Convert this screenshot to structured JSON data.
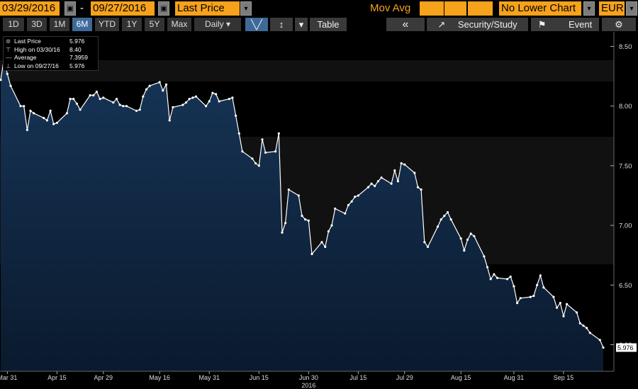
{
  "toolbar": {
    "start_date": "03/29/2016",
    "date_separator": "-",
    "end_date": "09/27/2016",
    "field": "Last Price",
    "mov_avg_label": "Mov Avg",
    "lower_chart": "No Lower Chart",
    "currency": "EUR",
    "calendar_icon": "▣",
    "dropdown_icon": "▾"
  },
  "periods": [
    "1D",
    "3D",
    "1M",
    "6M",
    "YTD",
    "1Y",
    "5Y",
    "Max"
  ],
  "active_period": "6M",
  "frequency": "Daily ▾",
  "tools": {
    "line_icon": "╲╱",
    "bar_icon": "↕",
    "dropdown": "▾",
    "table": "Table",
    "back": "«",
    "study_icon": "↗",
    "security_study": "Security/Study",
    "flag_icon": "⚑",
    "event": "Event",
    "gear_icon": "⚙"
  },
  "legend": [
    {
      "label": "Last Price",
      "value": "5.976"
    },
    {
      "label": "High on 03/30/16",
      "value": "8.40"
    },
    {
      "label": "Average",
      "value": "7.3959"
    },
    {
      "label": "Low on 09/27/16",
      "value": "5.976"
    }
  ],
  "colors": {
    "accent": "#f7a21b",
    "area_top": "#173557",
    "area_bottom": "#0a1a2e",
    "line": "#ffffff",
    "active": "#3d6a99"
  },
  "chart_data": {
    "type": "area",
    "x_axis_type": "date",
    "x_ticks": [
      "Mar 31",
      "Apr 15",
      "Apr 29",
      "May 16",
      "May 31",
      "Jun 15",
      "Jun 30",
      "Jul 15",
      "Jul 29",
      "Aug 15",
      "Aug 31",
      "Sep 15"
    ],
    "x_tick_dates": [
      "2016-03-31",
      "2016-04-15",
      "2016-04-29",
      "2016-05-16",
      "2016-05-31",
      "2016-06-15",
      "2016-06-30",
      "2016-07-15",
      "2016-07-29",
      "2016-08-15",
      "2016-08-31",
      "2016-09-15"
    ],
    "year_label": "2016",
    "y_ticks": [
      8.5,
      8.0,
      7.5,
      7.0,
      6.5,
      6.0
    ],
    "y_tick_labels": [
      "8.50",
      "8.00",
      "7.50",
      "7.00",
      "6.50",
      "6.00"
    ],
    "ylim": [
      5.75,
      8.55
    ],
    "last_value_label": "5.976",
    "grid": false,
    "series": [
      {
        "name": "Last Price",
        "x": [
          "2016-03-29",
          "2016-03-30",
          "2016-03-31",
          "2016-04-01",
          "2016-04-04",
          "2016-04-05",
          "2016-04-06",
          "2016-04-07",
          "2016-04-08",
          "2016-04-11",
          "2016-04-12",
          "2016-04-13",
          "2016-04-14",
          "2016-04-15",
          "2016-04-18",
          "2016-04-19",
          "2016-04-20",
          "2016-04-21",
          "2016-04-22",
          "2016-04-25",
          "2016-04-26",
          "2016-04-27",
          "2016-04-28",
          "2016-04-29",
          "2016-05-02",
          "2016-05-03",
          "2016-05-04",
          "2016-05-05",
          "2016-05-06",
          "2016-05-09",
          "2016-05-10",
          "2016-05-11",
          "2016-05-12",
          "2016-05-13",
          "2016-05-16",
          "2016-05-17",
          "2016-05-18",
          "2016-05-19",
          "2016-05-20",
          "2016-05-23",
          "2016-05-24",
          "2016-05-25",
          "2016-05-26",
          "2016-05-27",
          "2016-05-30",
          "2016-05-31",
          "2016-06-01",
          "2016-06-02",
          "2016-06-03",
          "2016-06-06",
          "2016-06-07",
          "2016-06-08",
          "2016-06-09",
          "2016-06-10",
          "2016-06-13",
          "2016-06-14",
          "2016-06-15",
          "2016-06-16",
          "2016-06-17",
          "2016-06-20",
          "2016-06-21",
          "2016-06-22",
          "2016-06-23",
          "2016-06-24",
          "2016-06-27",
          "2016-06-28",
          "2016-06-29",
          "2016-06-30",
          "2016-07-01",
          "2016-07-04",
          "2016-07-05",
          "2016-07-06",
          "2016-07-07",
          "2016-07-08",
          "2016-07-11",
          "2016-07-12",
          "2016-07-13",
          "2016-07-14",
          "2016-07-15",
          "2016-07-18",
          "2016-07-19",
          "2016-07-20",
          "2016-07-21",
          "2016-07-22",
          "2016-07-25",
          "2016-07-26",
          "2016-07-27",
          "2016-07-28",
          "2016-07-29",
          "2016-08-01",
          "2016-08-02",
          "2016-08-03",
          "2016-08-04",
          "2016-08-05",
          "2016-08-08",
          "2016-08-09",
          "2016-08-10",
          "2016-08-11",
          "2016-08-12",
          "2016-08-15",
          "2016-08-16",
          "2016-08-17",
          "2016-08-18",
          "2016-08-19",
          "2016-08-22",
          "2016-08-23",
          "2016-08-24",
          "2016-08-25",
          "2016-08-26",
          "2016-08-29",
          "2016-08-30",
          "2016-08-31",
          "2016-09-01",
          "2016-09-02",
          "2016-09-05",
          "2016-09-06",
          "2016-09-07",
          "2016-09-08",
          "2016-09-09",
          "2016-09-12",
          "2016-09-13",
          "2016-09-14",
          "2016-09-15",
          "2016-09-16",
          "2016-09-19",
          "2016-09-20",
          "2016-09-21",
          "2016-09-22",
          "2016-09-23",
          "2016-09-26",
          "2016-09-27"
        ],
        "y": [
          8.22,
          8.4,
          8.27,
          8.17,
          8.0,
          8.0,
          7.8,
          7.96,
          7.94,
          7.9,
          7.88,
          7.96,
          7.85,
          7.86,
          7.94,
          8.06,
          8.06,
          8.02,
          7.97,
          8.09,
          8.09,
          8.12,
          8.06,
          8.07,
          8.03,
          8.06,
          8.01,
          8.0,
          8.0,
          7.96,
          7.97,
          8.08,
          8.14,
          8.17,
          8.2,
          8.13,
          8.18,
          7.88,
          7.99,
          8.01,
          8.03,
          8.06,
          8.07,
          8.08,
          8.0,
          8.04,
          8.11,
          8.1,
          8.04,
          8.06,
          8.07,
          7.92,
          7.77,
          7.62,
          7.56,
          7.52,
          7.5,
          7.72,
          7.61,
          7.62,
          7.77,
          6.94,
          7.02,
          7.3,
          7.25,
          7.08,
          7.05,
          7.04,
          6.76,
          6.86,
          6.82,
          6.95,
          7.0,
          7.14,
          7.1,
          7.17,
          7.2,
          7.24,
          7.25,
          7.32,
          7.35,
          7.33,
          7.37,
          7.4,
          7.35,
          7.46,
          7.37,
          7.52,
          7.51,
          7.44,
          7.32,
          7.3,
          6.86,
          6.82,
          6.99,
          7.05,
          7.08,
          7.11,
          7.05,
          6.89,
          6.79,
          6.88,
          6.93,
          6.91,
          6.74,
          6.65,
          6.55,
          6.59,
          6.56,
          6.55,
          6.57,
          6.49,
          6.35,
          6.39,
          6.4,
          6.41,
          6.5,
          6.58,
          6.48,
          6.4,
          6.31,
          6.35,
          6.24,
          6.34,
          6.27,
          6.18,
          6.16,
          6.14,
          6.1,
          6.04,
          5.976
        ]
      }
    ]
  }
}
